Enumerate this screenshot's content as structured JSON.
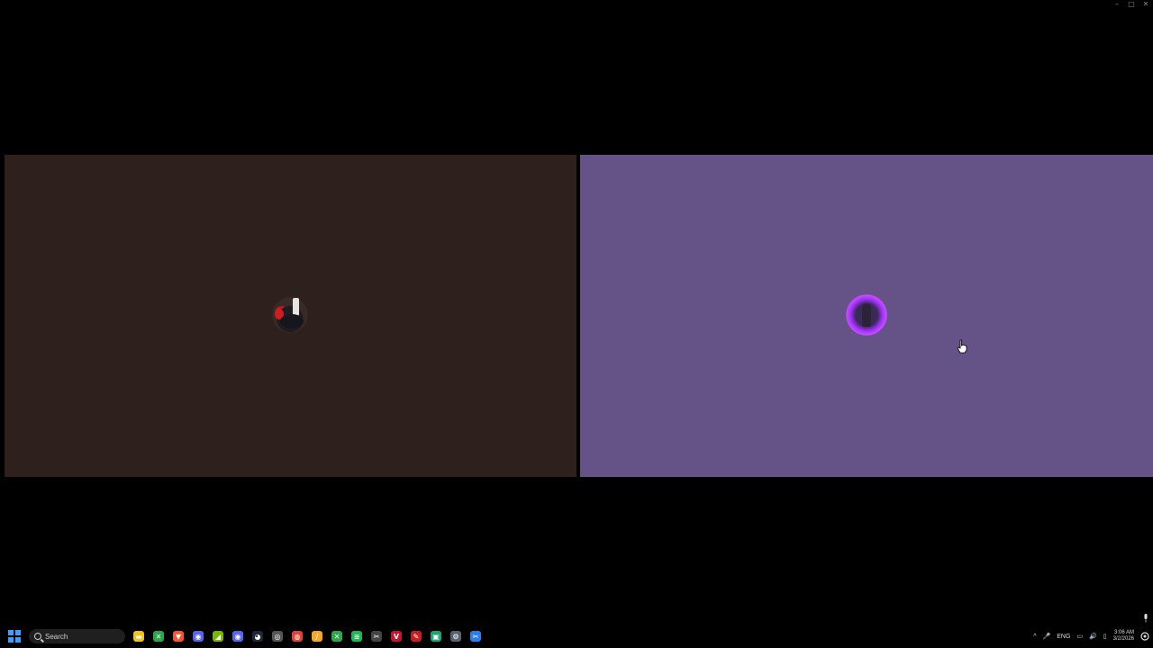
{
  "window": {
    "controls": {
      "minimize": "–",
      "maximize": "□",
      "close": "✕"
    }
  },
  "panels": [
    {
      "name": "left",
      "background": "#2e201d",
      "avatar_icon": "red-black-character-avatar-icon"
    },
    {
      "name": "right",
      "background": "#655287",
      "avatar_icon": "purple-glow-character-avatar-icon"
    }
  ],
  "taskbar": {
    "search_label": "Search",
    "apps": [
      {
        "icon": "file-explorer-icon",
        "glyph": "▬",
        "color": "#f0c419"
      },
      {
        "icon": "xbox-icon",
        "glyph": "✕",
        "color": "#2aa84a"
      },
      {
        "icon": "brave-icon",
        "glyph": "▼",
        "color": "#fb542b"
      },
      {
        "icon": "discord-icon",
        "glyph": "◉",
        "color": "#5865f2"
      },
      {
        "icon": "nvidia-icon",
        "glyph": "◢",
        "color": "#76b900"
      },
      {
        "icon": "discord-alt-icon",
        "glyph": "◉",
        "color": "#5865f2"
      },
      {
        "icon": "steam-icon",
        "glyph": "◕",
        "color": "#1b2838"
      },
      {
        "icon": "obs-icon",
        "glyph": "◎",
        "color": "#555555"
      },
      {
        "icon": "chrome-icon",
        "glyph": "◍",
        "color": "#e34133"
      },
      {
        "icon": "feather-app-icon",
        "glyph": "∕",
        "color": "#f5a623"
      },
      {
        "icon": "xbox-game-icon",
        "glyph": "✕",
        "color": "#2aa84a"
      },
      {
        "icon": "spotify-icon",
        "glyph": "≋",
        "color": "#1db954"
      },
      {
        "icon": "snipping-tool-icon",
        "glyph": "✂",
        "color": "#444444"
      },
      {
        "icon": "vivaldi-icon",
        "glyph": "V",
        "color": "#c8142b"
      },
      {
        "icon": "capcut-icon",
        "glyph": "✎",
        "color": "#c81e1e"
      },
      {
        "icon": "app-green-icon",
        "glyph": "▣",
        "color": "#1ea672"
      },
      {
        "icon": "settings-icon",
        "glyph": "⚙",
        "color": "#5a6270"
      },
      {
        "icon": "snip-sketch-icon",
        "glyph": "✂",
        "color": "#2b7de9"
      }
    ],
    "tray": {
      "chevron": "^",
      "mic": "🎤",
      "language": "ENG",
      "network": "▭",
      "volume": "🔊",
      "battery": "▯",
      "time": "3:06 AM",
      "date": "3/2/2026"
    }
  }
}
